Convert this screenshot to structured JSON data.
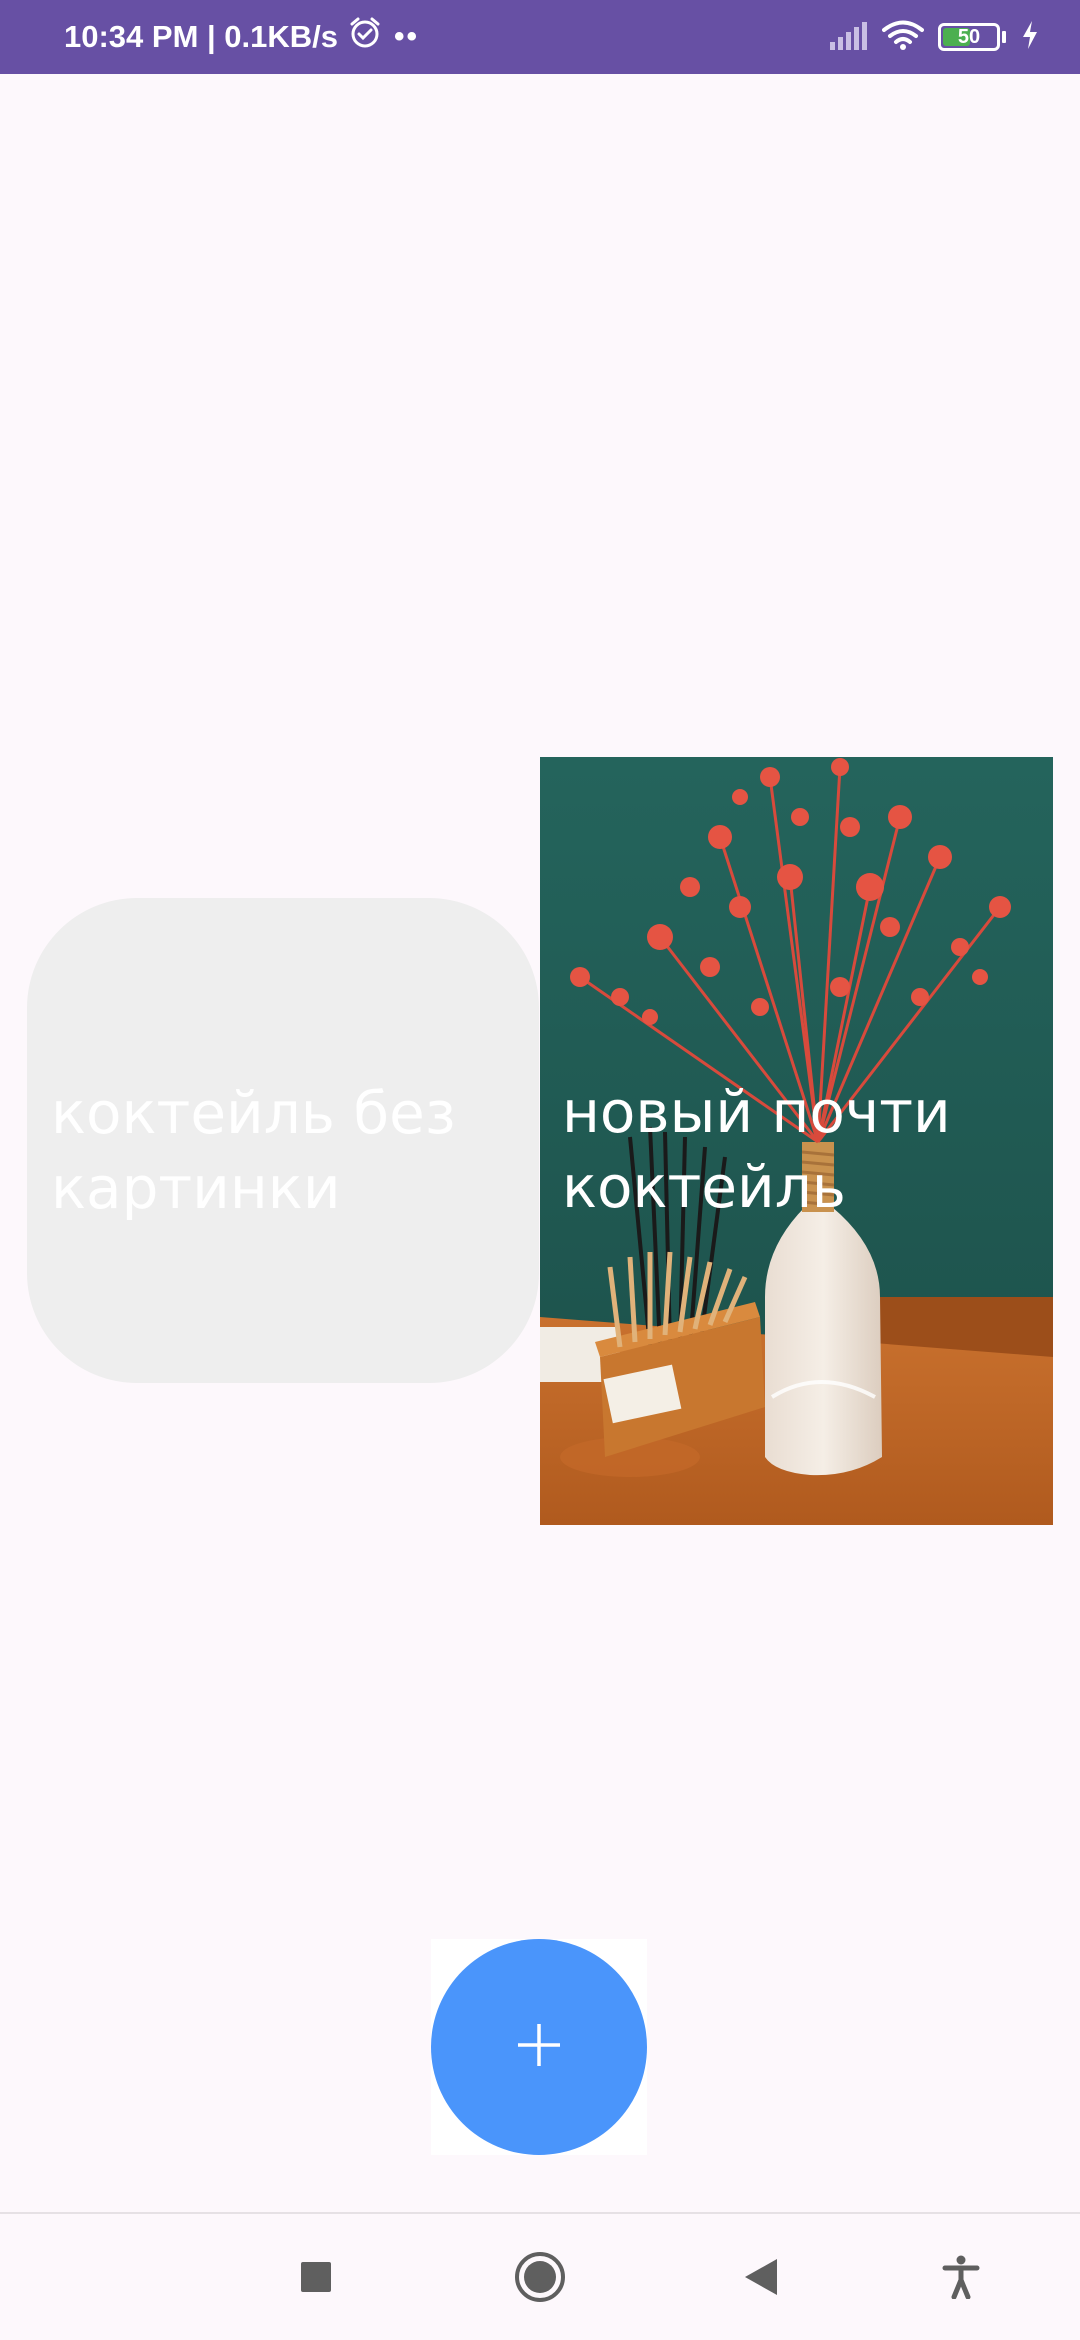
{
  "status_bar": {
    "time_speed": "10:34 PM | 0.1KB/s",
    "dots": "••",
    "battery_level": "50",
    "background_color": "#6750a4",
    "icons": [
      "alarm-icon",
      "signal-icon",
      "wifi-icon",
      "battery-icon",
      "charging-icon"
    ]
  },
  "cards": [
    {
      "title": "коктейль без картинки",
      "has_image": false,
      "background_color": "#eeeeee"
    },
    {
      "title": "новый почти коктейль",
      "has_image": true
    }
  ],
  "fab": {
    "icon": "plus-icon",
    "color": "#4a95fb"
  },
  "nav_bar": {
    "icons": [
      "recents-square-icon",
      "home-circle-icon",
      "back-triangle-icon",
      "accessibility-icon"
    ]
  }
}
